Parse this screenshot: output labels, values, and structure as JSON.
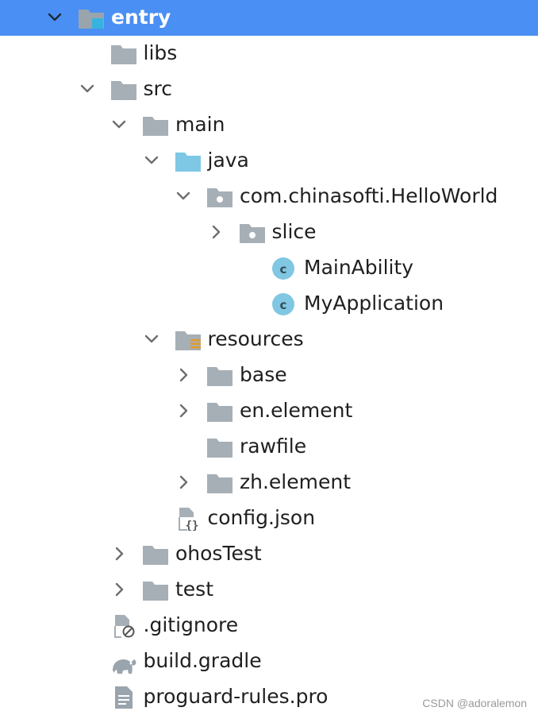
{
  "tree": {
    "rows": [
      {
        "label": "entry",
        "icon": "module-folder-icon",
        "arrow": "down",
        "selected": true
      },
      {
        "label": "libs",
        "icon": "folder-icon",
        "arrow": "none"
      },
      {
        "label": "src",
        "icon": "folder-icon",
        "arrow": "down"
      },
      {
        "label": "main",
        "icon": "folder-icon",
        "arrow": "down"
      },
      {
        "label": "java",
        "icon": "source-folder-icon",
        "arrow": "down"
      },
      {
        "label": "com.chinasofti.HelloWorld",
        "icon": "package-icon",
        "arrow": "down"
      },
      {
        "label": "slice",
        "icon": "package-icon",
        "arrow": "right"
      },
      {
        "label": "MainAbility",
        "icon": "class-icon",
        "arrow": "none"
      },
      {
        "label": "MyApplication",
        "icon": "class-icon",
        "arrow": "none"
      },
      {
        "label": "resources",
        "icon": "resources-folder-icon",
        "arrow": "down"
      },
      {
        "label": "base",
        "icon": "folder-icon",
        "arrow": "right"
      },
      {
        "label": "en.element",
        "icon": "folder-icon",
        "arrow": "right"
      },
      {
        "label": "rawfile",
        "icon": "folder-icon",
        "arrow": "none"
      },
      {
        "label": "zh.element",
        "icon": "folder-icon",
        "arrow": "right"
      },
      {
        "label": "config.json",
        "icon": "json-file-icon",
        "arrow": "none"
      },
      {
        "label": "ohosTest",
        "icon": "folder-icon",
        "arrow": "right"
      },
      {
        "label": "test",
        "icon": "folder-icon",
        "arrow": "right"
      },
      {
        "label": ".gitignore",
        "icon": "ignored-file-icon",
        "arrow": "none"
      },
      {
        "label": "build.gradle",
        "icon": "gradle-icon",
        "arrow": "none"
      },
      {
        "label": "proguard-rules.pro",
        "icon": "text-file-icon",
        "arrow": "none"
      }
    ]
  },
  "watermark": "CSDN @adoralemon",
  "colors": {
    "selection": "#4a8ff3",
    "folder": "#a7afb6",
    "source_folder": "#7ec8e6",
    "class_icon": "#7fc7e3",
    "text": "#1f1f1f"
  }
}
